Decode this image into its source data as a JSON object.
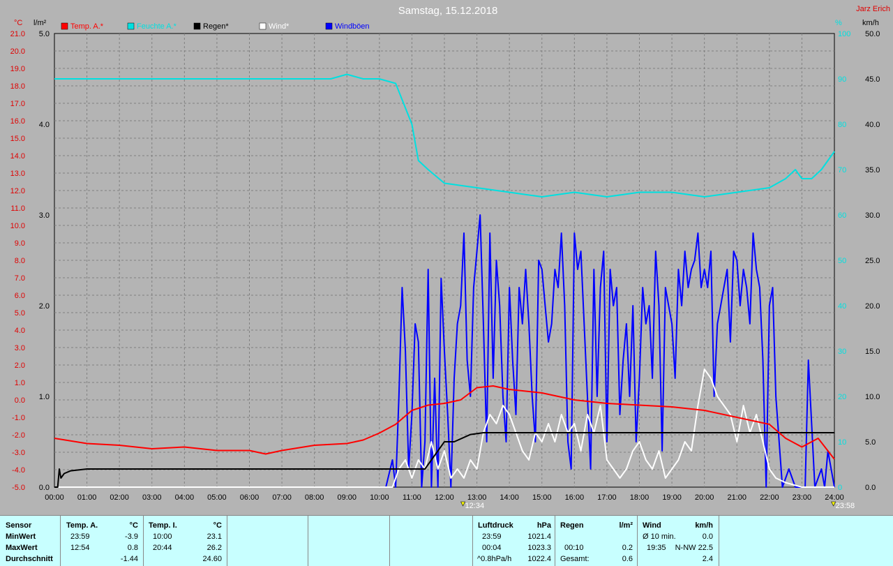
{
  "chart_data": {
    "type": "line",
    "title": "Samstag, 15.12.2018",
    "author": "Jarz Erich",
    "x_ticks": [
      "00:00",
      "01:00",
      "02:00",
      "03:00",
      "04:00",
      "05:00",
      "06:00",
      "07:00",
      "08:00",
      "09:00",
      "10:00",
      "11:00",
      "12:00",
      "13:00",
      "14:00",
      "15:00",
      "16:00",
      "17:00",
      "18:00",
      "19:00",
      "20:00",
      "21:00",
      "22:00",
      "23:00",
      "24:00"
    ],
    "markers": [
      {
        "x": 12.57,
        "label": "12:34"
      },
      {
        "x": 23.97,
        "label": "23:58"
      }
    ],
    "axes": {
      "temp": {
        "unit": "°C",
        "min": -5,
        "max": 21,
        "ticks": [
          "21.0",
          "20.0",
          "19.0",
          "18.0",
          "17.0",
          "16.0",
          "15.0",
          "14.0",
          "13.0",
          "12.0",
          "11.0",
          "10.0",
          "9.0",
          "8.0",
          "7.0",
          "6.0",
          "5.0",
          "4.0",
          "3.0",
          "2.0",
          "1.0",
          "0.0",
          "-1.0",
          "-2.0",
          "-3.0",
          "-4.0",
          "-5.0"
        ]
      },
      "rain": {
        "unit": "l/m²",
        "min": 0,
        "max": 5,
        "ticks": [
          "5.0",
          "4.0",
          "3.0",
          "2.0",
          "1.0",
          "0.0"
        ]
      },
      "humidity": {
        "unit": "%",
        "min": 0,
        "max": 100,
        "ticks": [
          "100",
          "90",
          "80",
          "70",
          "60",
          "50",
          "40",
          "30",
          "20",
          "10",
          "0"
        ]
      },
      "wind": {
        "unit": "km/h",
        "min": 0,
        "max": 50,
        "ticks": [
          "50.0",
          "45.0",
          "40.0",
          "35.0",
          "30.0",
          "25.0",
          "20.0",
          "15.0",
          "10.0",
          "5.0",
          "0.0"
        ]
      }
    },
    "grid": true,
    "legend_position": "top",
    "series": [
      {
        "name": "Temp. A.*",
        "color": "#ff0000",
        "axis": "temp",
        "x": [
          0,
          1,
          2,
          3,
          4,
          5,
          6,
          6.5,
          7,
          8,
          9,
          9.5,
          10,
          10.5,
          11,
          11.5,
          12,
          12.5,
          13,
          13.5,
          14,
          15,
          16,
          17,
          18,
          19,
          20,
          21,
          21.5,
          22,
          22.5,
          23,
          23.5,
          24
        ],
        "y": [
          -2.2,
          -2.5,
          -2.6,
          -2.8,
          -2.7,
          -2.9,
          -2.9,
          -3.1,
          -2.9,
          -2.6,
          -2.5,
          -2.3,
          -1.9,
          -1.4,
          -0.6,
          -0.3,
          -0.2,
          0.0,
          0.7,
          0.8,
          0.6,
          0.4,
          0.0,
          -0.2,
          -0.3,
          -0.4,
          -0.6,
          -1.0,
          -1.2,
          -1.4,
          -2.2,
          -2.7,
          -2.2,
          -3.4
        ]
      },
      {
        "name": "Feuchte A.*",
        "color": "#00e0e0",
        "axis": "humidity",
        "x": [
          0,
          7,
          8.5,
          9,
          9.5,
          10,
          10.5,
          11,
          11.2,
          11.5,
          12,
          13,
          14,
          15,
          16,
          17,
          18,
          19,
          20,
          21,
          22,
          22.5,
          22.8,
          23,
          23.3,
          23.6,
          24
        ],
        "y": [
          90,
          90,
          90,
          91,
          90,
          90,
          89,
          80,
          72,
          70,
          67,
          66,
          65,
          64,
          65,
          64,
          65,
          65,
          64,
          65,
          66,
          68,
          70,
          68,
          68,
          70,
          74
        ]
      },
      {
        "name": "Regen*",
        "color": "#000000",
        "axis": "rain",
        "x": [
          0,
          0.1,
          0.15,
          0.2,
          0.3,
          0.5,
          1,
          2,
          3,
          4,
          5,
          6,
          7,
          8,
          9,
          10,
          11,
          11.4,
          11.6,
          12,
          12.3,
          12.8,
          13.2,
          14,
          15,
          16,
          17,
          18,
          19,
          20,
          21,
          22,
          23,
          24
        ],
        "y": [
          0,
          0,
          0.2,
          0.1,
          0.15,
          0.18,
          0.2,
          0.2,
          0.2,
          0.2,
          0.2,
          0.2,
          0.2,
          0.2,
          0.2,
          0.2,
          0.2,
          0.2,
          0.3,
          0.5,
          0.5,
          0.58,
          0.6,
          0.6,
          0.6,
          0.6,
          0.6,
          0.6,
          0.6,
          0.6,
          0.6,
          0.6,
          0.6,
          0.6
        ]
      },
      {
        "name": "Wind*",
        "color": "#ffffff",
        "axis": "wind",
        "x": [
          0,
          10.4,
          10.6,
          10.8,
          11,
          11.2,
          11.4,
          11.6,
          11.8,
          12,
          12.2,
          12.4,
          12.6,
          12.8,
          13,
          13.2,
          13.4,
          13.6,
          13.8,
          14,
          14.2,
          14.4,
          14.6,
          14.8,
          15,
          15.2,
          15.4,
          15.6,
          15.8,
          16,
          16.2,
          16.4,
          16.6,
          16.8,
          17,
          17.2,
          17.4,
          17.6,
          17.8,
          18,
          18.2,
          18.4,
          18.6,
          18.8,
          19,
          19.2,
          19.4,
          19.6,
          19.8,
          20,
          20.2,
          20.4,
          20.6,
          20.8,
          21,
          21.2,
          21.4,
          21.6,
          21.8,
          22,
          22.2,
          22.5,
          23,
          24
        ],
        "y": [
          0,
          0,
          2,
          3,
          1,
          3,
          2,
          5,
          2,
          4,
          1,
          2,
          1,
          3,
          2,
          6,
          8,
          7,
          9,
          8,
          6,
          4,
          3,
          6,
          5,
          7,
          5,
          8,
          6,
          7,
          4,
          8,
          6,
          9,
          3,
          2,
          1,
          2,
          4,
          5,
          3,
          2,
          4,
          1,
          2,
          3,
          5,
          4,
          9,
          13,
          12,
          10,
          9,
          8,
          5,
          9,
          6,
          8,
          5,
          2,
          1,
          0.5,
          0,
          0
        ]
      },
      {
        "name": "Windböen",
        "color": "#0000ff",
        "axis": "wind",
        "x": [
          0,
          10.0,
          10.2,
          10.4,
          10.5,
          10.6,
          10.7,
          10.8,
          10.9,
          11.0,
          11.1,
          11.2,
          11.3,
          11.4,
          11.5,
          11.6,
          11.7,
          11.8,
          11.9,
          12.0,
          12.1,
          12.2,
          12.3,
          12.4,
          12.5,
          12.6,
          12.7,
          12.8,
          12.9,
          13.0,
          13.1,
          13.2,
          13.3,
          13.4,
          13.5,
          13.6,
          13.7,
          13.8,
          13.9,
          14.0,
          14.1,
          14.2,
          14.3,
          14.4,
          14.5,
          14.6,
          14.7,
          14.8,
          14.9,
          15.0,
          15.1,
          15.2,
          15.3,
          15.4,
          15.5,
          15.6,
          15.7,
          15.8,
          15.9,
          16.0,
          16.1,
          16.2,
          16.3,
          16.4,
          16.5,
          16.6,
          16.7,
          16.8,
          16.9,
          17.0,
          17.1,
          17.2,
          17.3,
          17.4,
          17.5,
          17.6,
          17.7,
          17.8,
          17.9,
          18.0,
          18.1,
          18.2,
          18.3,
          18.4,
          18.5,
          18.6,
          18.7,
          18.8,
          18.9,
          19.0,
          19.1,
          19.2,
          19.3,
          19.4,
          19.5,
          19.6,
          19.7,
          19.8,
          19.9,
          20.0,
          20.1,
          20.2,
          20.3,
          20.4,
          20.5,
          20.6,
          20.7,
          20.8,
          20.9,
          21.0,
          21.1,
          21.2,
          21.3,
          21.4,
          21.5,
          21.6,
          21.7,
          21.8,
          21.9,
          22.0,
          22.1,
          22.2,
          22.4,
          22.6,
          22.8,
          22.9,
          23.0,
          23.1,
          23.2,
          23.4,
          23.6,
          23.7,
          23.8,
          24
        ],
        "y": [
          0,
          0,
          0,
          3,
          0,
          10,
          22,
          15,
          2,
          8,
          18,
          16,
          0,
          5,
          24,
          0,
          12,
          0,
          23,
          15,
          8,
          0,
          12,
          18,
          20,
          28,
          14,
          10,
          22,
          26,
          30,
          18,
          5,
          28,
          12,
          25,
          20,
          10,
          5,
          22,
          14,
          8,
          22,
          18,
          24,
          18,
          10,
          5,
          25,
          24,
          20,
          16,
          18,
          24,
          22,
          28,
          20,
          5,
          2,
          28,
          24,
          26,
          18,
          10,
          2,
          24,
          10,
          22,
          26,
          5,
          24,
          20,
          22,
          8,
          14,
          18,
          10,
          20,
          5,
          12,
          22,
          18,
          20,
          12,
          26,
          20,
          4,
          22,
          20,
          18,
          12,
          24,
          20,
          26,
          22,
          24,
          25,
          28,
          22,
          24,
          22,
          26,
          10,
          18,
          20,
          22,
          24,
          16,
          26,
          25,
          20,
          24,
          22,
          18,
          28,
          24,
          22,
          14,
          0,
          20,
          22,
          10,
          0,
          2,
          0,
          0,
          0,
          0,
          14,
          0,
          2,
          0,
          4,
          0
        ]
      }
    ]
  },
  "stats": {
    "row_labels": [
      "Sensor",
      "MinWert",
      "MaxWert",
      "Durchschnitt"
    ],
    "temp_a": {
      "header": "Temp. A.",
      "unit": "°C",
      "min_time": "23:59",
      "min_value": "-3.9",
      "max_time": "12:54",
      "max_value": "0.8",
      "avg": "-1.44"
    },
    "temp_i": {
      "header": "Temp. I.",
      "unit": "°C",
      "min_time": "10:00",
      "min_value": "23.1",
      "max_time": "20:44",
      "max_value": "26.2",
      "avg": "24.60"
    },
    "pressure": {
      "header": "Luftdruck",
      "unit": "hPa",
      "min_time": "23:59",
      "min_value": "1021.4",
      "max_time": "00:04",
      "max_value": "1023.3",
      "trend_label": "^0.8hPa/h",
      "trend_value": "1022.4"
    },
    "rain": {
      "header": "Regen",
      "unit": "l/m²",
      "max_time": "00:10",
      "max_value": "0.2",
      "total_label": "Gesamt:",
      "total_value": "0.6"
    },
    "wind": {
      "header": "Wind",
      "unit": "km/h",
      "avg_label": "Ø 10 min.",
      "avg_value": "0.0",
      "gust_time": "19:35",
      "gust_value": "N-NW 22.5",
      "avg_day": "2.4"
    }
  }
}
